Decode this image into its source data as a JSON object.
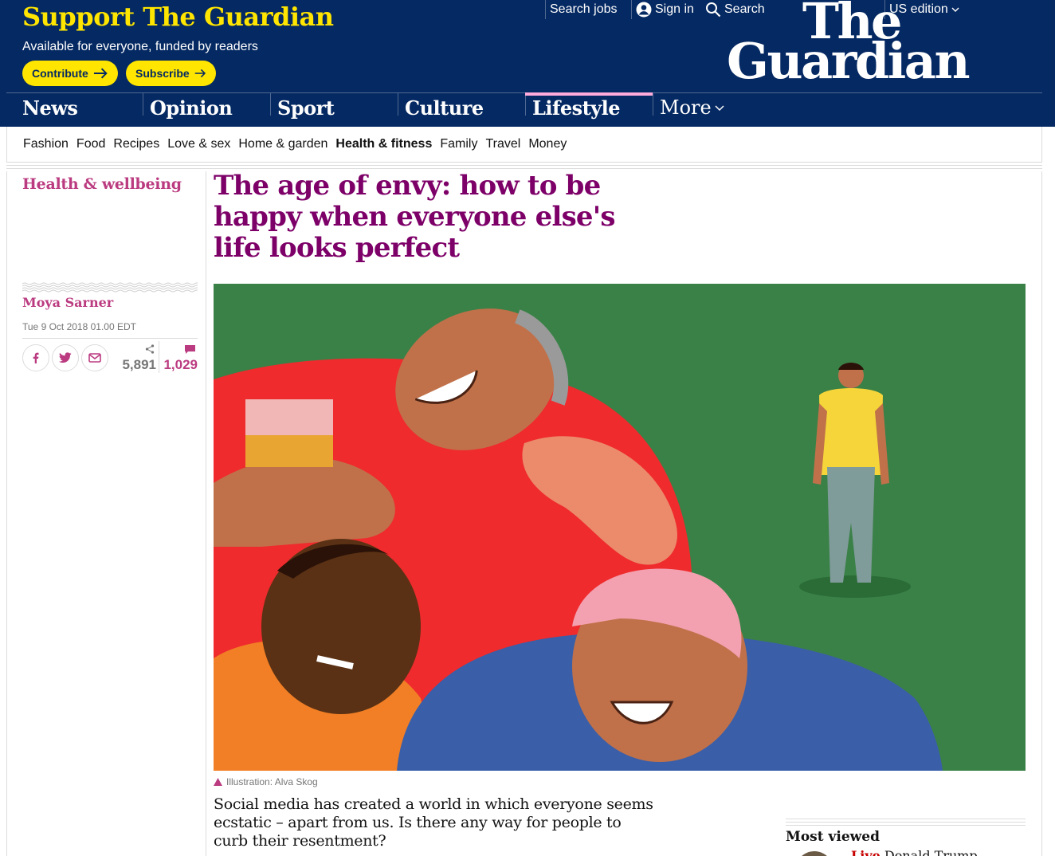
{
  "support": {
    "title": "Support The Guardian",
    "subtitle": "Available for everyone, funded by readers",
    "contribute_label": "Contribute",
    "subscribe_label": "Subscribe"
  },
  "top_links": {
    "search_jobs": "Search jobs",
    "sign_in": "Sign in",
    "search": "Search",
    "edition": "US edition"
  },
  "logo": {
    "line1": "The",
    "line2": "Guardian"
  },
  "pillars": {
    "news": "News",
    "opinion": "Opinion",
    "sport": "Sport",
    "culture": "Culture",
    "lifestyle": "Lifestyle",
    "more": "More"
  },
  "subnav": [
    "Fashion",
    "Food",
    "Recipes",
    "Love & sex",
    "Home & garden",
    "Health & fitness",
    "Family",
    "Travel",
    "Money"
  ],
  "article": {
    "section": "Health & wellbeing",
    "headline": "The age of envy: how to be happy when everyone else's life looks perfect",
    "byline": "Moya Sarner",
    "date": "Tue 9 Oct 2018 01.00 EDT",
    "share_count": "5,891",
    "comment_count": "1,029",
    "caption": "Illustration: Alva Skog",
    "standfirst": "Social media has created a world in which everyone seems ecstatic – apart from us. Is there any way for people to curb their resentment?"
  },
  "most_viewed": {
    "title": "Most viewed",
    "item_live": "Live",
    "item_text": "Donald Trump"
  },
  "colors": {
    "brand_blue": "#052962",
    "support_yellow": "#ffe500",
    "lifestyle_pink": "#bb3b80",
    "headline_purple": "#7d0068",
    "lifestyle_accent": "#ffabdb"
  }
}
